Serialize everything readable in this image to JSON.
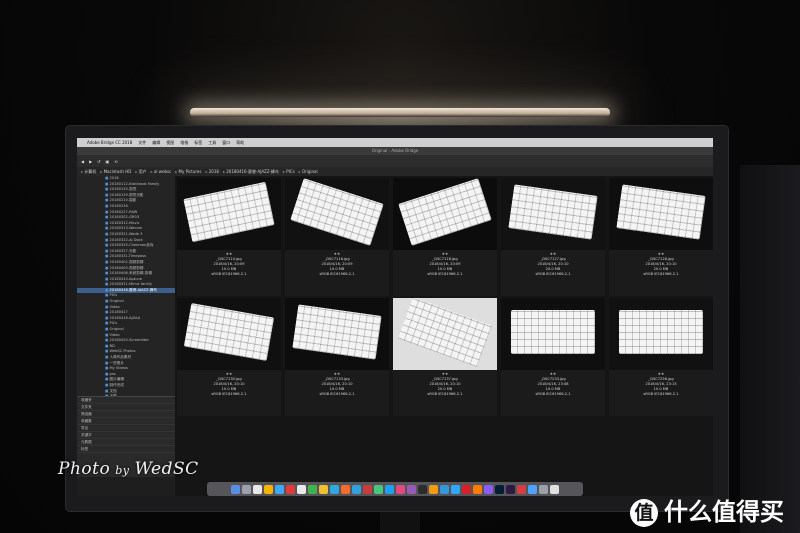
{
  "photo": {
    "menubar": [
      "Adobe Bridge CC 2018",
      "文件",
      "编辑",
      "视图",
      "堆栈",
      "标签",
      "工具",
      "窗口",
      "帮助"
    ],
    "window_title": "Original - Adobe Bridge",
    "path": [
      "计算机",
      "Macintosh HD",
      "用户",
      "ai websc",
      "My Pictures",
      "2018",
      "20180416-赛睿-AJAZZ-蜂鸟",
      "PICs",
      "Original"
    ],
    "folders": [
      "2018",
      "20180112-Kiskbrook Family",
      "20180120-视觉",
      "20180129-视觉光影",
      "20180210-摄影",
      "20180226",
      "20180227-RAW",
      "20180302-GR03",
      "20180312-Mavic",
      "20180313-Wacom",
      "20180321-Wade 3",
      "20180322-AJ Dock",
      "20180325-Cheerson游戏",
      "20180327-光影",
      "20180331-Timepass",
      "20180402-视频剪辑",
      "20180405-视频剪辑",
      "20180406-系统剪辑-剪辑",
      "20180410-Aptune",
      "20180411-Mimic family",
      "20180416-赛睿-AJAZZ-蜂鸟",
      "PICs",
      "Original",
      "Video",
      "20180417",
      "20180418-AJZAA",
      "PICs",
      "Original",
      "Video",
      "20180420-Screentiter",
      "BD",
      "WebSC Photos",
      "人像作品素材",
      "一些照片",
      "My Videos",
      "pss",
      "图片编辑",
      "制作完成",
      "文档",
      "下载",
      "桌面",
      "应用",
      "Movies",
      "照片"
    ],
    "selected_folder": "20180416-赛睿-AJAZZ-蜂鸟",
    "filters": [
      "收藏夹",
      "文件夹",
      "筛选器",
      "收藏集",
      "导出",
      "关键字",
      "元数据",
      "标签"
    ],
    "thumbnails": [
      {
        "file": "_DSC7114.jpg",
        "date": "2018/4/16, 20:09",
        "size": "10.0 MB",
        "profile": "sRGB IEC61966-2.1",
        "stars": "★★"
      },
      {
        "file": "_DSC7116.jpg",
        "date": "2018/4/16, 20:09",
        "size": "10.0 MB",
        "profile": "sRGB IEC61966-2.1",
        "stars": "★★"
      },
      {
        "file": "_DSC7118.jpg",
        "date": "2018/4/16, 20:09",
        "size": "10.0 MB",
        "profile": "sRGB IEC61966-2.1",
        "stars": "★★"
      },
      {
        "file": "_DSC7127.jpg",
        "date": "2018/4/16, 20:10",
        "size": "20.0 MB",
        "profile": "sRGB IEC61966-2.1",
        "stars": "★★"
      },
      {
        "file": "_DSC7128.jpg",
        "date": "2018/4/16, 20:10",
        "size": "20.0 MB",
        "profile": "sRGB IEC61966-2.1",
        "stars": "★★"
      },
      {
        "file": "_DSC7130.jpg",
        "date": "2018/4/16, 20:10",
        "size": "10.0 MB",
        "profile": "sRGB IEC61966-2.1",
        "stars": "★★"
      },
      {
        "file": "_DSC7133.jpg",
        "date": "2018/4/16, 20:10",
        "size": "10.0 MB",
        "profile": "sRGB IEC61966-2.1",
        "stars": "★★"
      },
      {
        "file": "_DSC7137.jpg",
        "date": "2018/4/16, 20:10",
        "size": "20.0 MB",
        "profile": "sRGB IEC61966-2.1",
        "stars": "★★"
      },
      {
        "file": "_DSC7233.jpg",
        "date": "2018/4/16, 23:48",
        "size": "10.0 MB",
        "profile": "sRGB IEC61966-2.1",
        "stars": "★★"
      },
      {
        "file": "_DSC7256.jpg",
        "date": "2018/4/16, 23:13",
        "size": "10.0 MB",
        "profile": "sRGB IEC61966-2.1",
        "stars": "★★"
      }
    ],
    "watermark": {
      "left": "Photo",
      "by": "by",
      "right": "WedSC"
    },
    "brand": {
      "mark": "值",
      "text": "什么值得买"
    }
  }
}
